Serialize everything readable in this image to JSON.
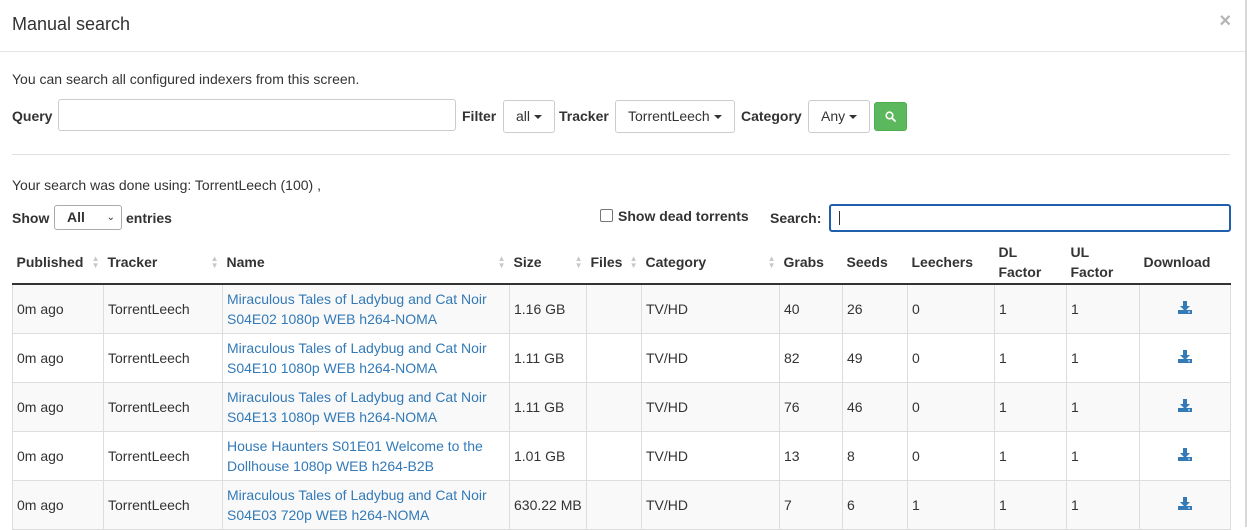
{
  "modal": {
    "title": "Manual search",
    "close": "×"
  },
  "intro": "You can search all configured indexers from this screen.",
  "query_bar": {
    "query_label": "Query",
    "query_value": "",
    "filter_label": "Filter",
    "filter_value": "all",
    "tracker_label": "Tracker",
    "tracker_value": "TorrentLeech",
    "category_label": "Category",
    "category_value": "Any",
    "search_icon": "search-icon"
  },
  "search_info": "Your search was done using: TorrentLeech (100) ,",
  "entries": {
    "show_label": "Show",
    "selected": "All",
    "entries_label": "entries"
  },
  "dead_torrents_label": "Show dead torrents",
  "search_label": "Search:",
  "columns": [
    "Published",
    "Tracker",
    "Name",
    "Size",
    "Files",
    "Category",
    "Grabs",
    "Seeds",
    "Leechers",
    "DL Factor",
    "UL Factor",
    "Download"
  ],
  "rows": [
    {
      "published": "0m ago",
      "tracker": "TorrentLeech",
      "name": "Miraculous Tales of Ladybug and Cat Noir S04E02 1080p WEB h264-NOMA",
      "size": "1.16 GB",
      "files": "",
      "category": "TV/HD",
      "grabs": "40",
      "seeds": "26",
      "leechers": "0",
      "dl_factor": "1",
      "ul_factor": "1"
    },
    {
      "published": "0m ago",
      "tracker": "TorrentLeech",
      "name": "Miraculous Tales of Ladybug and Cat Noir S04E10 1080p WEB h264-NOMA",
      "size": "1.11 GB",
      "files": "",
      "category": "TV/HD",
      "grabs": "82",
      "seeds": "49",
      "leechers": "0",
      "dl_factor": "1",
      "ul_factor": "1"
    },
    {
      "published": "0m ago",
      "tracker": "TorrentLeech",
      "name": "Miraculous Tales of Ladybug and Cat Noir S04E13 1080p WEB h264-NOMA",
      "size": "1.11 GB",
      "files": "",
      "category": "TV/HD",
      "grabs": "76",
      "seeds": "46",
      "leechers": "0",
      "dl_factor": "1",
      "ul_factor": "1"
    },
    {
      "published": "0m ago",
      "tracker": "TorrentLeech",
      "name": "House Haunters S01E01 Welcome to the Dollhouse 1080p WEB h264-B2B",
      "size": "1.01 GB",
      "files": "",
      "category": "TV/HD",
      "grabs": "13",
      "seeds": "8",
      "leechers": "0",
      "dl_factor": "1",
      "ul_factor": "1"
    },
    {
      "published": "0m ago",
      "tracker": "TorrentLeech",
      "name": "Miraculous Tales of Ladybug and Cat Noir S04E03 720p WEB h264-NOMA",
      "size": "630.22 MB",
      "files": "",
      "category": "TV/HD",
      "grabs": "7",
      "seeds": "6",
      "leechers": "1",
      "dl_factor": "1",
      "ul_factor": "1"
    }
  ],
  "colors": {
    "link": "#337ab7",
    "search_button": "#5cb85c",
    "download_icon": "#337ab7",
    "focus_border": "#1f5fae"
  }
}
